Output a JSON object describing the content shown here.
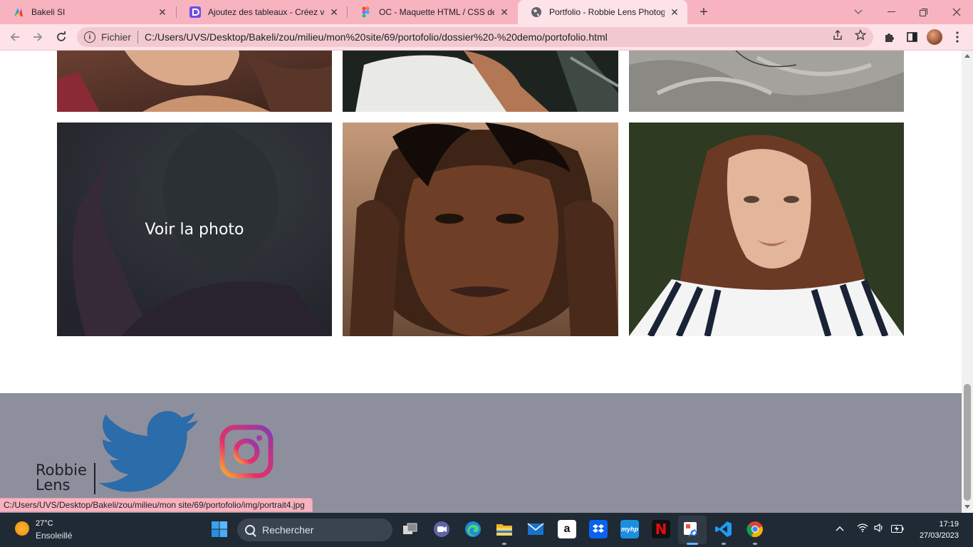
{
  "browser": {
    "tabs": [
      {
        "title": "Bakeli SI",
        "active": false
      },
      {
        "title": "Ajoutez des tableaux - Créez votre",
        "active": false
      },
      {
        "title": "OC - Maquette HTML / CSS desktop",
        "active": false
      },
      {
        "title": "Portfolio - Robbie Lens Photographe",
        "active": true
      }
    ],
    "scheme_label": "Fichier",
    "url": "C:/Users/UVS/Desktop/Bakeli/zou/milieu/mon%20site/69/portofolio/dossier%20-%20demo/portofolio.html",
    "status_url": "C:/Users/UVS/Desktop/Bakeli/zou/milieu/mon site/69/portofolio/img/portrait4.jpg"
  },
  "page": {
    "hover_label": "Voir la photo",
    "photos": [
      {
        "name": "portrait-top-left"
      },
      {
        "name": "portrait-top-middle"
      },
      {
        "name": "portrait-top-right"
      },
      {
        "name": "portrait4",
        "hovered": true
      },
      {
        "name": "portrait5"
      },
      {
        "name": "portrait6"
      }
    ],
    "footer": {
      "logo_line1": "Robbie",
      "logo_line2": "Lens",
      "social": [
        "twitter-icon",
        "instagram-icon"
      ]
    }
  },
  "taskbar": {
    "temperature": "27°C",
    "condition": "Ensoleillé",
    "search_placeholder": "Rechercher",
    "time": "17:19",
    "date": "27/03/2023",
    "apps": [
      "file-explorer-icon",
      "teams-icon",
      "edge-icon",
      "folder-icon",
      "mail-icon",
      "amazon-icon",
      "dropbox-icon",
      "myhp-icon",
      "netflix-icon",
      "snipping-tool-icon",
      "vscode-icon",
      "chrome-icon"
    ]
  },
  "colors": {
    "tabstrip": "#f7b3c0",
    "toolbar": "#fde2e7",
    "footer": "#8e8f9c",
    "twitter": "#2b6cab",
    "taskbar": "#1f2a35"
  }
}
